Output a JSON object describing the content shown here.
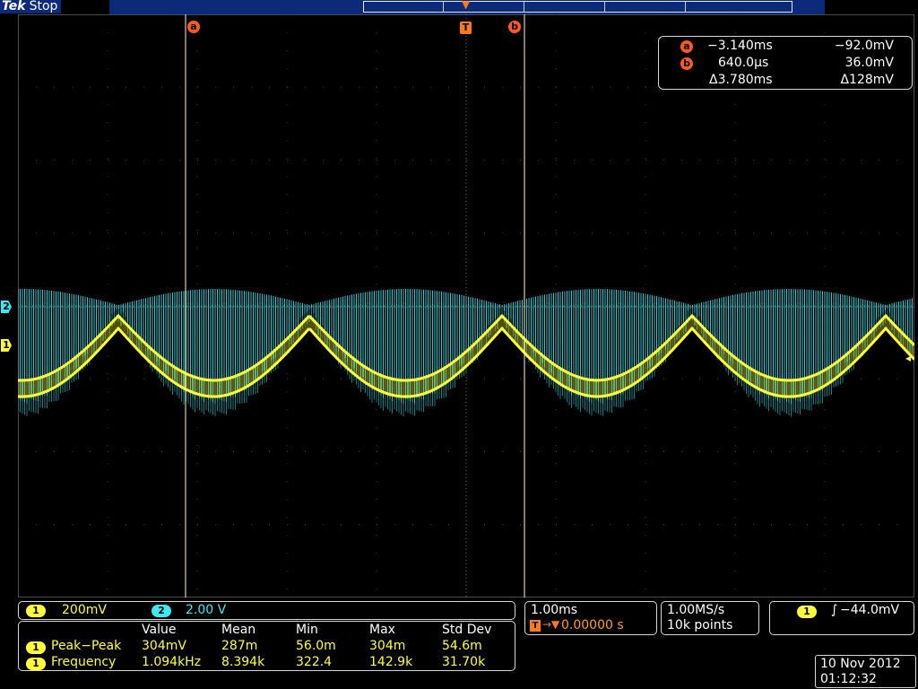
{
  "header": {
    "brand": "Tek",
    "status": "Stop"
  },
  "cursors": {
    "a_label": "a",
    "b_label": "b",
    "trigger_label": "T",
    "readout": {
      "a_time": "−3.140ms",
      "a_volt": "−92.0mV",
      "b_time": "640.0µs",
      "b_volt": "36.0mV",
      "delta_time": "Δ3.780ms",
      "delta_volt": "Δ128mV"
    }
  },
  "channels": {
    "ch1": {
      "label": "1",
      "scale": "200mV",
      "color": "#ffff3a"
    },
    "ch2": {
      "label": "2",
      "scale": "2.00 V",
      "color": "#3ee8f0"
    }
  },
  "measurements": {
    "headers": [
      "Value",
      "Mean",
      "Min",
      "Max",
      "Std Dev"
    ],
    "rows": [
      {
        "channel": "1",
        "name": "Peak−Peak",
        "value": "304mV",
        "mean": "287m",
        "min": "56.0m",
        "max": "304m",
        "std": "54.6m"
      },
      {
        "channel": "1",
        "name": "Frequency",
        "value": "1.094kHz",
        "mean": "8.394k",
        "min": "322.4",
        "max": "142.9k",
        "std": "31.70k"
      }
    ]
  },
  "horizontal": {
    "scale": "1.00ms",
    "position": "0.00000 s"
  },
  "acquisition": {
    "rate": "1.00MS/s",
    "points": "10k points"
  },
  "trigger": {
    "channel": "1",
    "level": "−44.0mV"
  },
  "datetime": {
    "date": "10 Nov 2012",
    "time": "01:12:32"
  }
}
